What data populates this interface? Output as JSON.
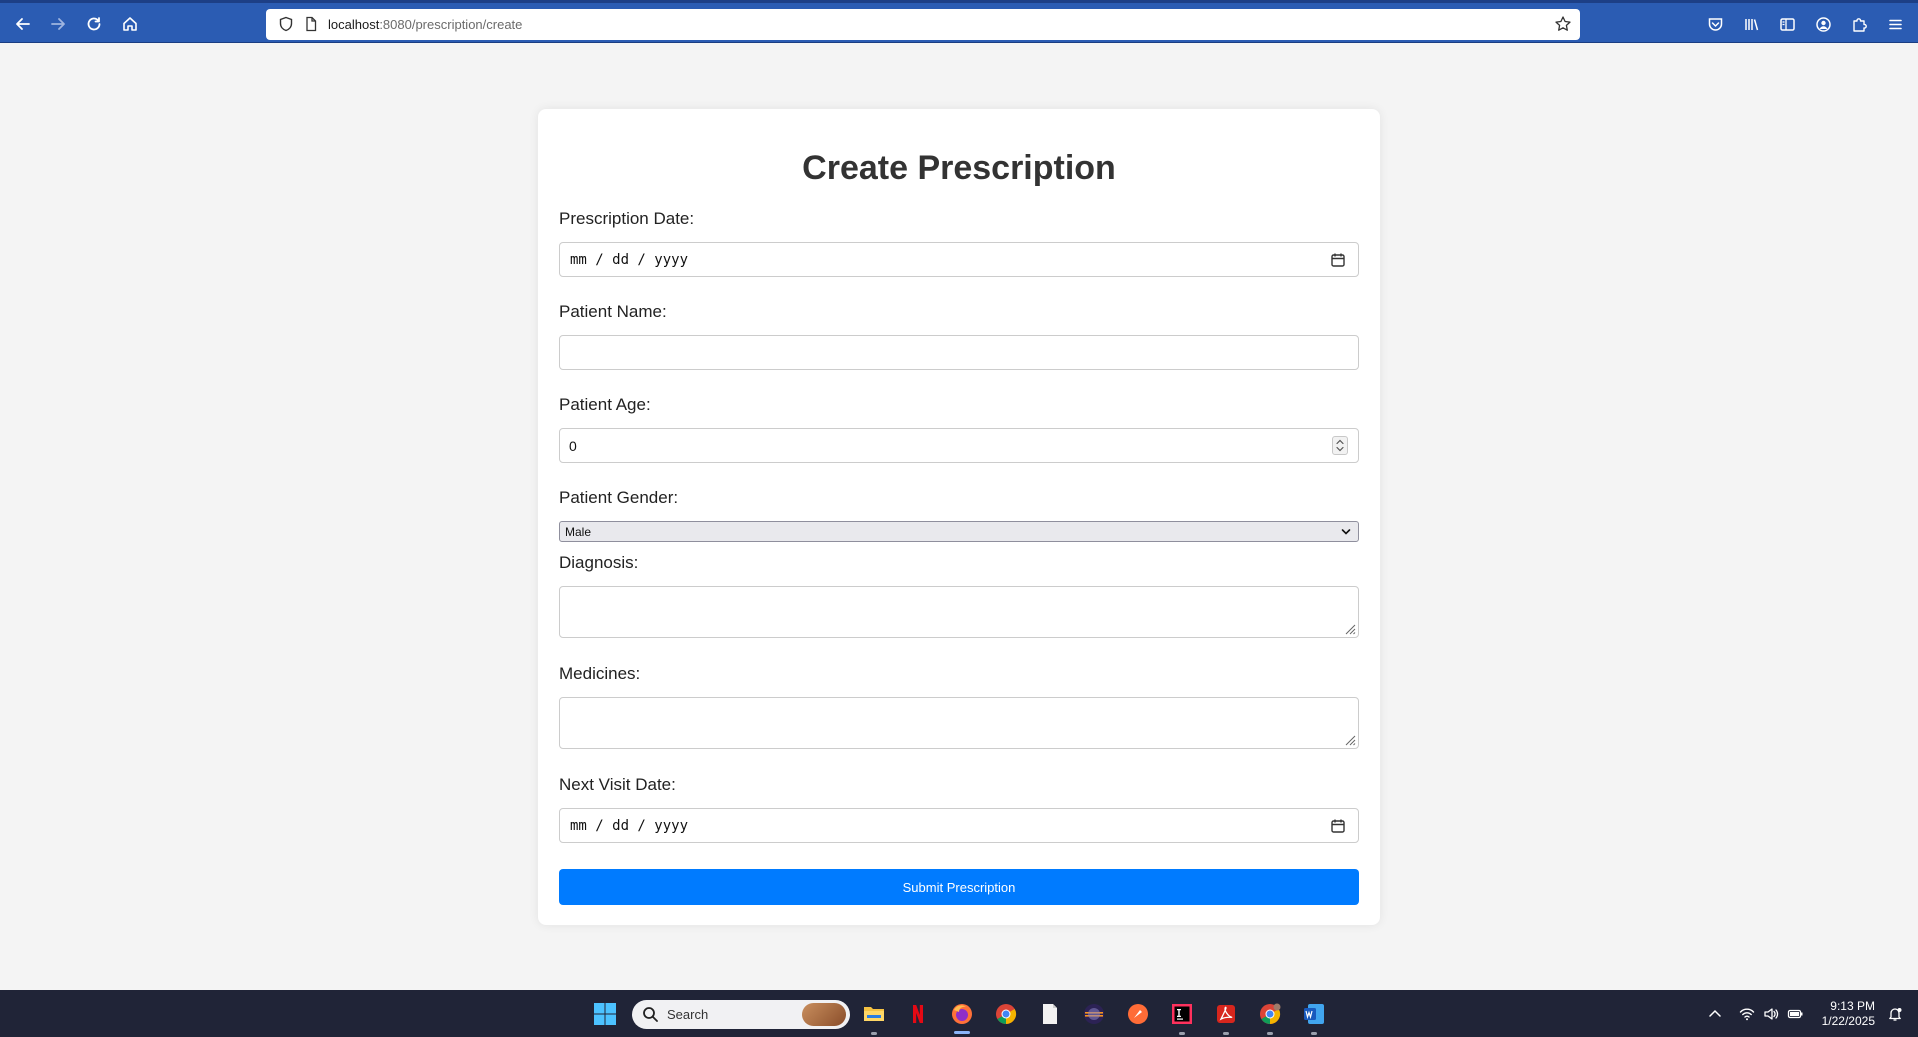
{
  "browser": {
    "url_host": "localhost",
    "url_rest": ":8080/prescription/create",
    "accent": "#2b5cb3"
  },
  "form": {
    "title": "Create Prescription",
    "prescription_date_label": "Prescription Date:",
    "prescription_date_placeholder": "mm / dd / yyyy",
    "patient_name_label": "Patient Name:",
    "patient_name_value": "",
    "patient_age_label": "Patient Age:",
    "patient_age_value": "0",
    "patient_gender_label": "Patient Gender:",
    "patient_gender_value": "Male",
    "diagnosis_label": "Diagnosis:",
    "diagnosis_value": "",
    "medicines_label": "Medicines:",
    "medicines_value": "",
    "next_visit_date_label": "Next Visit Date:",
    "next_visit_date_placeholder": "mm / dd / yyyy",
    "submit_label": "Submit Prescription",
    "submit_color": "#007bff"
  },
  "taskbar": {
    "search_label": "Search",
    "time": "9:13 PM",
    "date": "1/22/2025"
  }
}
